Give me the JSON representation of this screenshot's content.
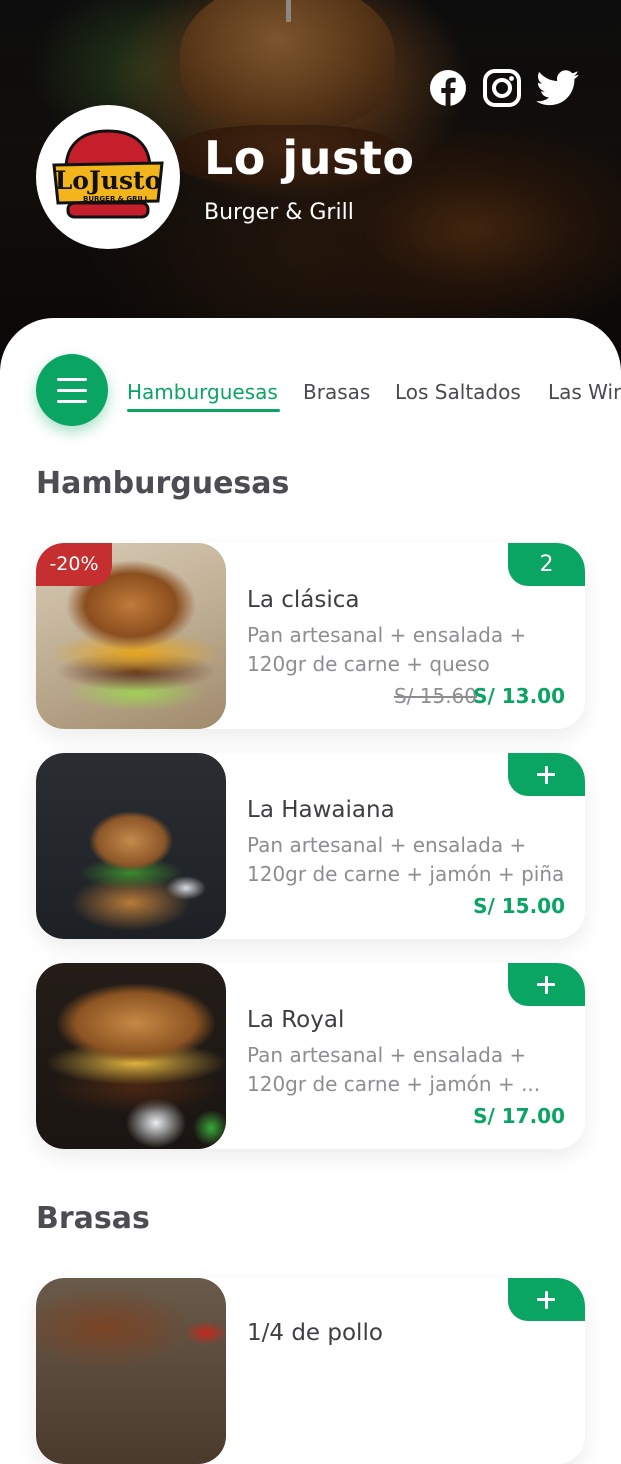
{
  "header": {
    "brand_name": "Lo justo",
    "tagline": "Burger & Grill",
    "logo_text": "LoJusto",
    "logo_subtext": "BURGER & GRILL",
    "social": [
      "facebook-icon",
      "instagram-icon",
      "twitter-icon"
    ]
  },
  "nav": {
    "menu_icon": "hamburger-menu-icon",
    "tabs": [
      {
        "label": "Hamburguesas",
        "active": true
      },
      {
        "label": "Brasas",
        "active": false
      },
      {
        "label": "Los Saltados",
        "active": false
      },
      {
        "label": "Las Wings",
        "active": false
      }
    ]
  },
  "sections": [
    {
      "title": "Hamburguesas",
      "items": [
        {
          "name": "La clásica",
          "description": "Pan artesanal + ensalada + 120gr de carne + queso",
          "old_price": "S/ 15.60",
          "price": "S/ 13.00",
          "discount": "-20%",
          "quantity": "2"
        },
        {
          "name": "La Hawaiana",
          "description": "Pan artesanal + ensalada + 120gr de carne + jamón + piña",
          "price": "S/ 15.00"
        },
        {
          "name": "La Royal",
          "description": "Pan artesanal + ensalada + 120gr de carne + jamón + ...",
          "price": "S/ 17.00"
        }
      ]
    },
    {
      "title": "Brasas",
      "items": [
        {
          "name": "1/4 de pollo"
        }
      ]
    }
  ],
  "colors": {
    "accent": "#0aa562",
    "discount": "#c62f2f",
    "title": "#4c4c52"
  }
}
